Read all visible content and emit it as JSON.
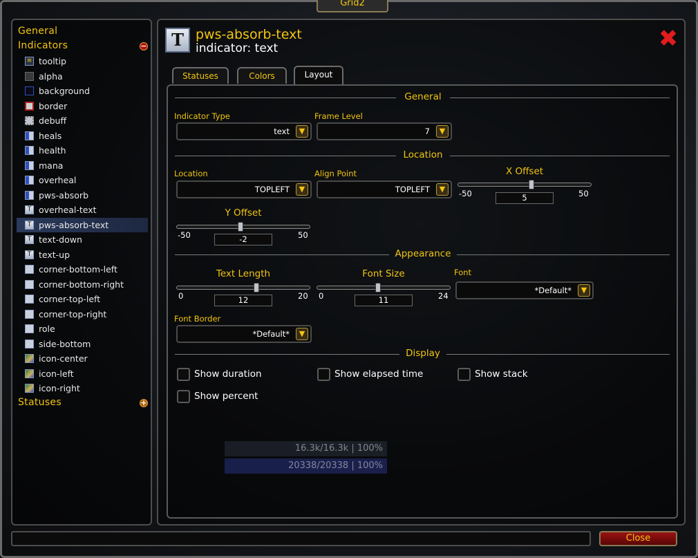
{
  "window": {
    "title": "Grid2"
  },
  "tree": {
    "general_label": "General",
    "indicators_label": "Indicators",
    "indicators_toggle": "−",
    "statuses_label": "Statuses",
    "statuses_toggle": "+",
    "items": [
      {
        "label": "tooltip",
        "icon": "tooltip-icon"
      },
      {
        "label": "alpha",
        "icon": "alpha-icon"
      },
      {
        "label": "background",
        "icon": "background-icon"
      },
      {
        "label": "border",
        "icon": "border-icon"
      },
      {
        "label": "debuff",
        "icon": "debuff-icon"
      },
      {
        "label": "heals",
        "icon": "bar-icon"
      },
      {
        "label": "health",
        "icon": "bar-icon"
      },
      {
        "label": "mana",
        "icon": "bar-icon"
      },
      {
        "label": "overheal",
        "icon": "bar-icon"
      },
      {
        "label": "pws-absorb",
        "icon": "bar-icon"
      },
      {
        "label": "overheal-text",
        "icon": "text-icon"
      },
      {
        "label": "pws-absorb-text",
        "icon": "text-icon",
        "selected": true
      },
      {
        "label": "text-down",
        "icon": "text-icon"
      },
      {
        "label": "text-up",
        "icon": "text-icon"
      },
      {
        "label": "corner-bottom-left",
        "icon": "square-icon"
      },
      {
        "label": "corner-bottom-right",
        "icon": "square-icon"
      },
      {
        "label": "corner-top-left",
        "icon": "square-icon"
      },
      {
        "label": "corner-top-right",
        "icon": "square-icon"
      },
      {
        "label": "role",
        "icon": "square-icon"
      },
      {
        "label": "side-bottom",
        "icon": "square-icon"
      },
      {
        "label": "icon-center",
        "icon": "image-icon"
      },
      {
        "label": "icon-left",
        "icon": "image-icon"
      },
      {
        "label": "icon-right",
        "icon": "image-icon"
      }
    ]
  },
  "header": {
    "icon_glyph": "T",
    "title": "pws-absorb-text",
    "subtitle": "indicator: text",
    "close_glyph": "✖"
  },
  "tabs": [
    {
      "label": "Statuses"
    },
    {
      "label": "Colors"
    },
    {
      "label": "Layout",
      "active": true
    }
  ],
  "sections": {
    "general": "General",
    "location": "Location",
    "appearance": "Appearance",
    "display": "Display"
  },
  "fields": {
    "indicator_type": {
      "label": "Indicator Type",
      "value": "text"
    },
    "frame_level": {
      "label": "Frame Level",
      "value": "7"
    },
    "location": {
      "label": "Location",
      "value": "TOPLEFT"
    },
    "align_point": {
      "label": "Align Point",
      "value": "TOPLEFT"
    },
    "font": {
      "label": "Font",
      "value": "*Default*"
    },
    "font_border": {
      "label": "Font Border",
      "value": "*Default*"
    }
  },
  "sliders": {
    "x_offset": {
      "label": "X Offset",
      "min": "-50",
      "max": "50",
      "value": "5",
      "fraction": 0.55
    },
    "y_offset": {
      "label": "Y Offset",
      "min": "-50",
      "max": "50",
      "value": "-2",
      "fraction": 0.48
    },
    "text_length": {
      "label": "Text Length",
      "min": "0",
      "max": "20",
      "value": "12",
      "fraction": 0.6
    },
    "font_size": {
      "label": "Font Size",
      "min": "0",
      "max": "24",
      "value": "11",
      "fraction": 0.46
    }
  },
  "checks": {
    "show_duration": "Show duration",
    "show_elapsed": "Show elapsed time",
    "show_stack": "Show stack",
    "show_percent": "Show percent"
  },
  "background_frames": {
    "health": "16.3k/16.3k | 100%",
    "mana": "20338/20338 | 100%"
  },
  "footer": {
    "close_label": "Close"
  },
  "colors": {
    "gold": "#f2c511",
    "red": "#e01c1c",
    "selected_row": "#2b3a5c"
  }
}
